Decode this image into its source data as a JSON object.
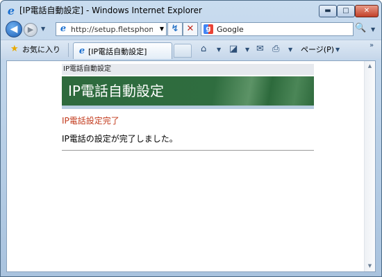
{
  "window": {
    "title": "[IP電話自動設定] - Windows Internet Explorer",
    "minimize_glyph": "▬",
    "maximize_glyph": "□",
    "close_glyph": "✕"
  },
  "address_bar": {
    "url": "http://setup.fletsphone/",
    "search_placeholder": "Google"
  },
  "command_bar": {
    "favorites_label": "お気に入り",
    "tab_label": "[IP電話自動設定]",
    "page_menu_label": "ページ(P)"
  },
  "icons": {
    "ie": "e",
    "back": "◀",
    "forward": "▶",
    "dropdown": "▼",
    "refresh": "↯",
    "stop": "✕",
    "search": "🔍",
    "star": "★",
    "home": "⌂",
    "feeds": "◪",
    "mail": "✉",
    "print": "⎙",
    "more": "»",
    "scroll_up": "▲",
    "scroll_down": "▼",
    "google": "g"
  },
  "page": {
    "breadcrumb": "IP電話自動設定",
    "banner_title": "IP電話自動設定",
    "status_heading": "IP電話設定完了",
    "status_message": "IP電話の設定が完了しました。"
  },
  "colors": {
    "banner_green": "#2f6d3f",
    "status_red": "#c2391b"
  }
}
